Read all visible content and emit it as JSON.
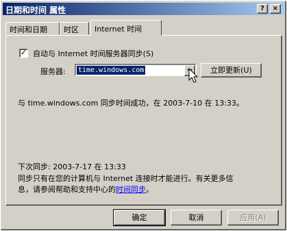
{
  "window": {
    "title": "日期和时间 属性",
    "help_glyph": "?",
    "close_glyph": "×"
  },
  "tabs": [
    {
      "label": "时间和日期",
      "active": false
    },
    {
      "label": "时区",
      "active": false
    },
    {
      "label": "Internet 时间",
      "active": true
    }
  ],
  "internet_time": {
    "auto_sync_label": "自动与 Internet 时间服务器同步(S)",
    "auto_sync_checked": true,
    "check_glyph": "✓",
    "server_label": "服务器:",
    "server_value": "time.windows.com",
    "update_button_label": "立即更新(U)",
    "sync_status": "与 time.windows.com 同步时间成功，在 2003-7-10 在 13:33。",
    "next_sync": "下次同步: 2003-7-17 在 13:33",
    "info_text_line1": "同步只有在您的计算机与 Internet 连接时才能进行。有关更多信",
    "info_text_line2_prefix": "息，请参阅帮助和支持中心的",
    "info_link": "时间同步",
    "info_text_line2_suffix": "。"
  },
  "footer": {
    "ok_label": "确定",
    "cancel_label": "取消",
    "apply_label": "应用(A)"
  },
  "icons": {
    "cursor": "mouse-pointer-icon"
  }
}
